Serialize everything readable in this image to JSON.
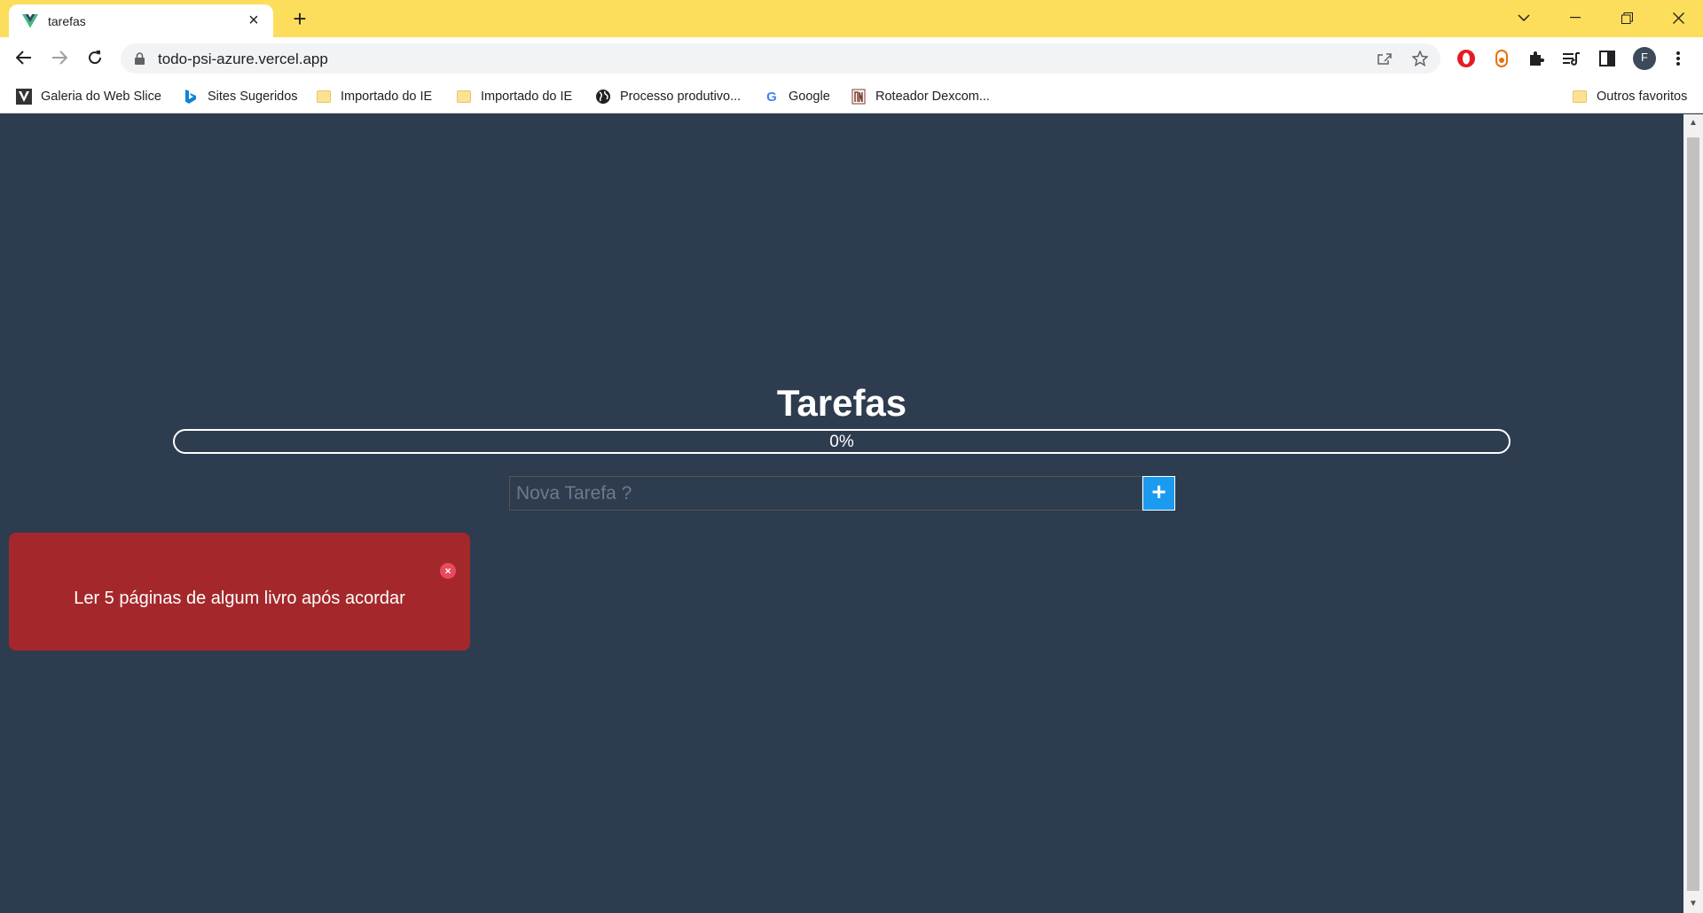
{
  "browser": {
    "tab": {
      "title": "tarefas",
      "favicon": "vue-logo-icon"
    },
    "url": "todo-psi-azure.vercel.app",
    "profile_initial": "F",
    "bookmarks": [
      {
        "label": "Galeria do Web Slice",
        "icon": "web-slice-icon"
      },
      {
        "label": "Sites Sugeridos",
        "icon": "bing-icon"
      },
      {
        "label": "Importado do IE",
        "icon": "folder-icon"
      },
      {
        "label": "Importado do IE",
        "icon": "folder-icon"
      },
      {
        "label": "Processo produtivo...",
        "icon": "globe-icon"
      },
      {
        "label": "Google",
        "icon": "google-icon"
      },
      {
        "label": "Roteador Dexcom...",
        "icon": "router-icon"
      }
    ],
    "other_bookmarks": "Outros favoritos",
    "theme_color": "#fdde5c"
  },
  "app": {
    "title": "Tarefas",
    "progress": {
      "value": 0,
      "label": "0%"
    },
    "new_task_placeholder": "Nova Tarefa ?",
    "add_button": "+",
    "tasks": [
      {
        "text": "Ler 5 páginas de algum livro após acordar",
        "done": false,
        "color": "#a4282b"
      }
    ],
    "background_color": "#2e3c4f",
    "accent_color": "#1a9bf0"
  }
}
